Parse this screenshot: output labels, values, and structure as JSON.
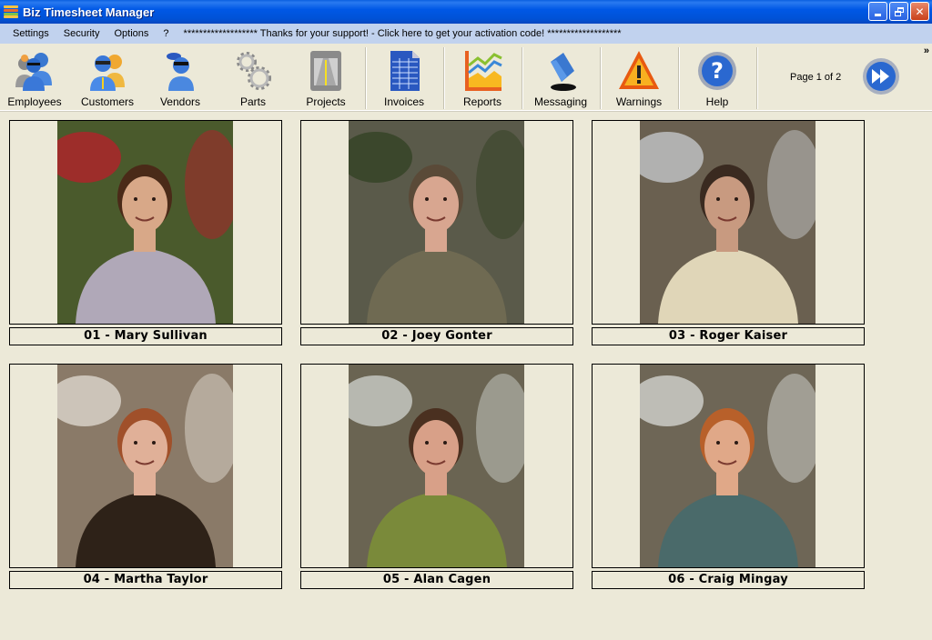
{
  "window": {
    "title": "Biz Timesheet Manager",
    "controls": [
      "minimize",
      "restore",
      "close"
    ]
  },
  "menu": {
    "items": [
      "Settings",
      "Security",
      "Options",
      "?"
    ],
    "activation_link": "******************* Thanks for your support! - Click here to get your activation code! *******************"
  },
  "toolbar": {
    "buttons": [
      {
        "label": "Employees",
        "icon": "employees-icon"
      },
      {
        "label": "Customers",
        "icon": "customers-icon"
      },
      {
        "label": "Vendors",
        "icon": "vendors-icon"
      },
      {
        "label": "Parts",
        "icon": "gears-icon"
      },
      {
        "label": "Projects",
        "icon": "projects-icon"
      },
      {
        "label": "Invoices",
        "icon": "invoice-document-icon"
      },
      {
        "label": "Reports",
        "icon": "chart-icon"
      },
      {
        "label": "Messaging",
        "icon": "scroll-message-icon"
      },
      {
        "label": "Warnings",
        "icon": "warning-triangle-icon"
      },
      {
        "label": "Help",
        "icon": "help-question-icon"
      }
    ],
    "page_info": "Page 1 of 2",
    "next_page_icon": "fast-forward-icon",
    "overflow_icon": "chevron-double-right-icon",
    "overflow_glyph": "»"
  },
  "employees": [
    {
      "label": "01 - Mary Sullivan",
      "photo": {
        "bg": "#4a5a2c",
        "accent": "#c0192a",
        "hair": "#4a2a18",
        "skin": "#d8a888",
        "shirt": "#b0a8b8"
      }
    },
    {
      "label": "02 - Joey Gonter",
      "photo": {
        "bg": "#5a5a4a",
        "accent": "#2e3e20",
        "hair": "#5a4a38",
        "skin": "#d8a690",
        "shirt": "#6f6a52"
      }
    },
    {
      "label": "03 - Roger Kaiser",
      "photo": {
        "bg": "#6a6050",
        "accent": "#d0d4d8",
        "hair": "#3a2a20",
        "skin": "#c89a80",
        "shirt": "#e0d6b8"
      }
    },
    {
      "label": "04 - Martha Taylor",
      "photo": {
        "bg": "#8a7a68",
        "accent": "#e8e4dc",
        "hair": "#a0502a",
        "skin": "#e0b098",
        "shirt": "#2e2218"
      }
    },
    {
      "label": "05 - Alan Cagen",
      "photo": {
        "bg": "#6a6452",
        "accent": "#d8dcd8",
        "hair": "#4a3020",
        "skin": "#d8a088",
        "shirt": "#7a8a3a"
      }
    },
    {
      "label": "06 - Craig Mingay",
      "photo": {
        "bg": "#6e6656",
        "accent": "#e0e2e0",
        "hair": "#b8602a",
        "skin": "#e0a888",
        "shirt": "#4a6a6a"
      }
    }
  ]
}
